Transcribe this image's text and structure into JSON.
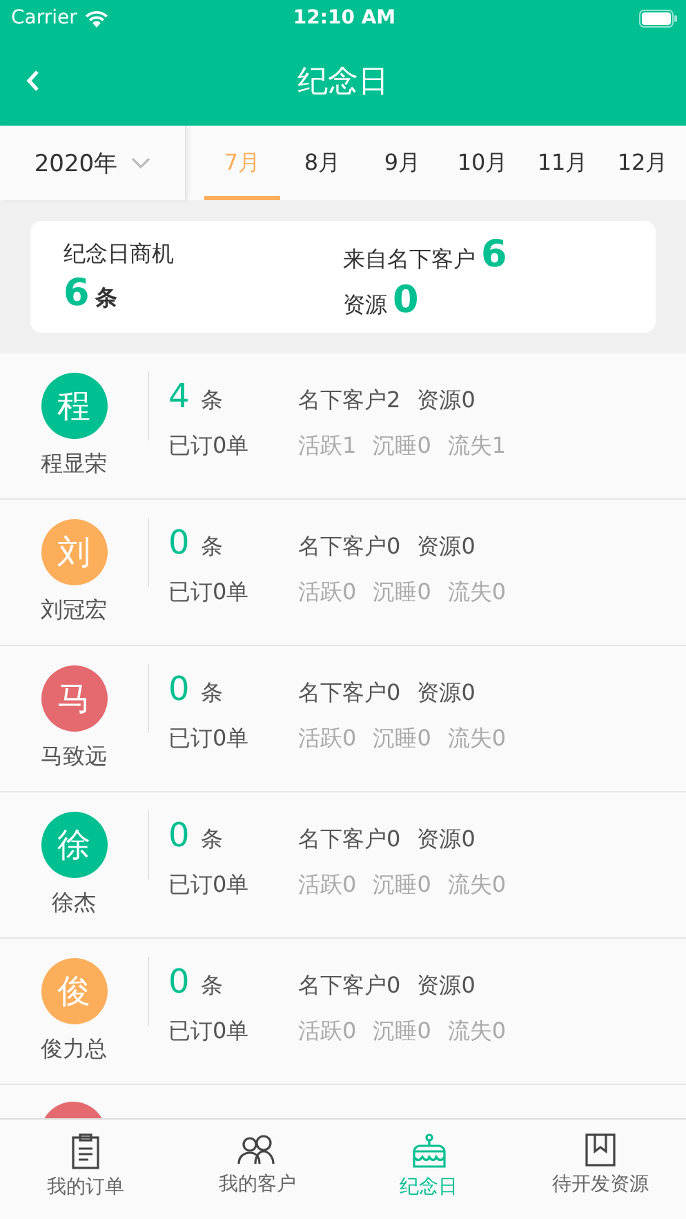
{
  "status_bar": {
    "carrier": "Carrier",
    "time": "12:10 AM"
  },
  "header": {
    "title": "纪念日"
  },
  "year_picker": {
    "label": "2020年"
  },
  "months": [
    {
      "label": "7月",
      "selected": true
    },
    {
      "label": "8月",
      "selected": false
    },
    {
      "label": "9月",
      "selected": false
    },
    {
      "label": "10月",
      "selected": false
    },
    {
      "label": "11月",
      "selected": false
    },
    {
      "label": "12月",
      "selected": false
    }
  ],
  "summary": {
    "title": "纪念日商机",
    "total": "6",
    "total_unit": "条",
    "from_customers_label": "来自名下客户",
    "from_customers": "6",
    "from_resources_label": "资源",
    "from_resources": "0"
  },
  "people": [
    {
      "initial": "程",
      "name": "程显荣",
      "color": "#00bf91",
      "count": "4",
      "unit": "条",
      "customers": "名下客户2",
      "resources": "资源0",
      "ordered": "已订0单",
      "active": "活跃1",
      "sleeping": "沉睡0",
      "lost": "流失1"
    },
    {
      "initial": "刘",
      "name": "刘冠宏",
      "color": "#fdae5b",
      "count": "0",
      "unit": "条",
      "customers": "名下客户0",
      "resources": "资源0",
      "ordered": "已订0单",
      "active": "活跃0",
      "sleeping": "沉睡0",
      "lost": "流失0"
    },
    {
      "initial": "马",
      "name": "马致远",
      "color": "#e46a6f",
      "count": "0",
      "unit": "条",
      "customers": "名下客户0",
      "resources": "资源0",
      "ordered": "已订0单",
      "active": "活跃0",
      "sleeping": "沉睡0",
      "lost": "流失0"
    },
    {
      "initial": "徐",
      "name": "徐杰",
      "color": "#00bf91",
      "count": "0",
      "unit": "条",
      "customers": "名下客户0",
      "resources": "资源0",
      "ordered": "已订0单",
      "active": "活跃0",
      "sleeping": "沉睡0",
      "lost": "流失0"
    },
    {
      "initial": "俊",
      "name": "俊力总",
      "color": "#fdae5b",
      "count": "0",
      "unit": "条",
      "customers": "名下客户0",
      "resources": "资源0",
      "ordered": "已订0单",
      "active": "活跃0",
      "sleeping": "沉睡0",
      "lost": "流失0"
    }
  ],
  "partial_row": {
    "color": "#e46a6f"
  },
  "tab_bar": [
    {
      "label": "我的订单",
      "kind": "orders",
      "selected": false
    },
    {
      "label": "我的客户",
      "kind": "customers",
      "selected": false
    },
    {
      "label": "纪念日",
      "kind": "cake",
      "selected": true
    },
    {
      "label": "待开发资源",
      "kind": "bookmark",
      "selected": false
    }
  ]
}
